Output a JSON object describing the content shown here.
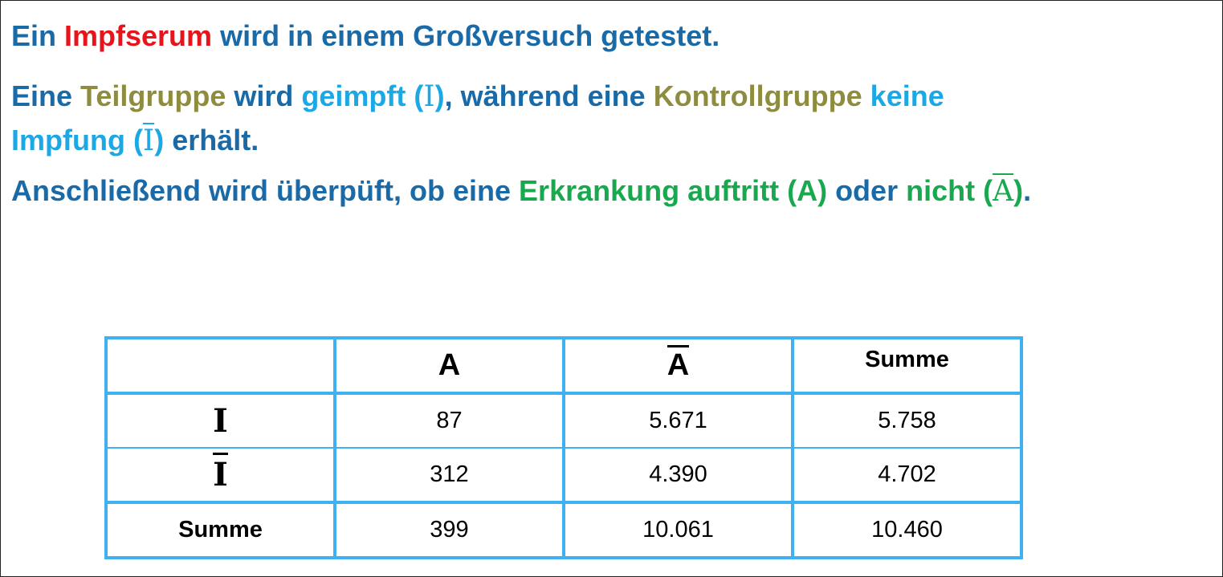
{
  "line1": {
    "part1": "Ein ",
    "highlight": "Impfserum",
    "part2": " wird in einem Großversuch getestet."
  },
  "line2": {
    "part1": "Eine ",
    "teilgruppe": "Teilgruppe",
    "wird": " wird ",
    "geimpft": "geimpft (",
    "sym_I": "I",
    "close": ")",
    "mid": ", während eine ",
    "kontrollgruppe": "Kontrollgruppe",
    "space": " ",
    "keine": "keine"
  },
  "line3": {
    "impfung": "Impfung (",
    "sym_Ibar": "I",
    "close": ")",
    "erhaelt": " erhält."
  },
  "line4": {
    "part1": "Anschließend wird überpüft, ob eine ",
    "erkrankung": "Erkrankung auftritt (A)",
    "oder": " oder ",
    "nicht": "nicht (",
    "sym_Abar": "A",
    "close": ")",
    "end": "."
  },
  "table": {
    "header": {
      "empty": "",
      "a": "A",
      "abar": "A",
      "summe": "Summe"
    },
    "rows": [
      {
        "label": "I",
        "a": "87",
        "abar": "5.671",
        "summe": "5.758"
      },
      {
        "label": "I",
        "a": "312",
        "abar": "4.390",
        "summe": "4.702"
      },
      {
        "label": "Summe",
        "a": "399",
        "abar": "10.061",
        "summe": "10.460"
      }
    ]
  },
  "colors": {
    "blue": "#1a6aa8",
    "red": "#e8141b",
    "olive": "#8e8c3e",
    "cyan": "#1ca8e4",
    "green": "#18a94e",
    "table_border": "#3fb0f0"
  }
}
